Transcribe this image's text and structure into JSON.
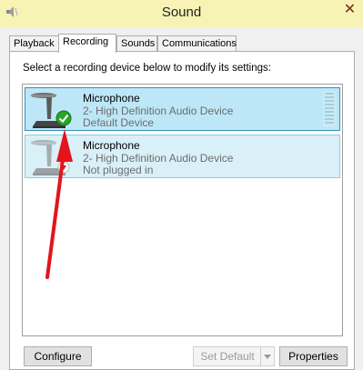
{
  "window": {
    "title": "Sound",
    "close_glyph": "✕"
  },
  "tabs": [
    {
      "label": "Playback",
      "active": false
    },
    {
      "label": "Recording",
      "active": true
    },
    {
      "label": "Sounds",
      "active": false
    },
    {
      "label": "Communications",
      "active": false
    }
  ],
  "instruction": "Select a recording device below to modify its settings:",
  "devices": [
    {
      "name": "Microphone",
      "description": "2- High Definition Audio Device",
      "status": "Default Device",
      "status_icon": "green-checkmark-icon",
      "selected": true
    },
    {
      "name": "Microphone",
      "description": "2- High Definition Audio Device",
      "status": "Not plugged in",
      "status_icon": "red-down-arrow-icon",
      "selected": false
    }
  ],
  "buttons": {
    "configure": "Configure",
    "set_default": "Set Default",
    "properties": "Properties"
  },
  "colors": {
    "titlebar": "#f6f3b4",
    "selected_row": "#bde7f7",
    "row": "#d9f0f8",
    "annotation_arrow": "#e3141b"
  }
}
